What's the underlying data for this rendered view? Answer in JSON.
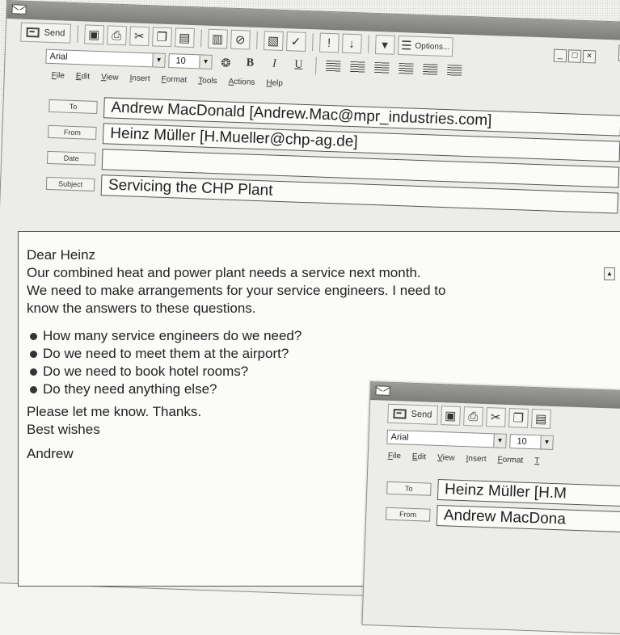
{
  "toolbar": {
    "send_label": "Send",
    "options_label": "Options...",
    "help_label": "?"
  },
  "format": {
    "font": "Arial",
    "size": "10",
    "bold": "B",
    "italic": "I",
    "underline": "U"
  },
  "menu": [
    "File",
    "Edit",
    "View",
    "Insert",
    "Format",
    "Tools",
    "Actions",
    "Help"
  ],
  "email": {
    "to_label": "To",
    "from_label": "From",
    "date_label": "Date",
    "subject_label": "Subject",
    "to": "Andrew MacDonald [Andrew.Mac@mpr_industries.com]",
    "from": "Heinz Müller [H.Mueller@chp-ag.de]",
    "date": "",
    "subject": "Servicing the CHP Plant",
    "greeting": "Dear Heinz",
    "para1": "Our combined heat and power plant needs a service next month.",
    "para2": "We need to make arrangements for your service engineers. I need to",
    "para3": "know the answers to these questions.",
    "bullets": [
      "How many service engineers do we need?",
      "Do we need to meet them at the airport?",
      "Do we need to book hotel rooms?",
      "Do they need anything else?"
    ],
    "closing1": "Please let me know. Thanks.",
    "closing2": "Best wishes",
    "signature": "Andrew"
  },
  "second_window": {
    "send_label": "Send",
    "font": "Arial",
    "size": "10",
    "menu": [
      "File",
      "Edit",
      "View",
      "Insert",
      "Format",
      "T"
    ],
    "to_label": "To",
    "from_label": "From",
    "to": "Heinz Müller [H.M",
    "from": "Andrew MacDona"
  },
  "icons": [
    "envelope-icon",
    "save-icon",
    "print-icon",
    "cut-icon",
    "copy-icon",
    "paste-icon",
    "address-book-icon",
    "attach-icon",
    "check-names-icon",
    "flag-icon",
    "importance-icon",
    "options-icon"
  ]
}
